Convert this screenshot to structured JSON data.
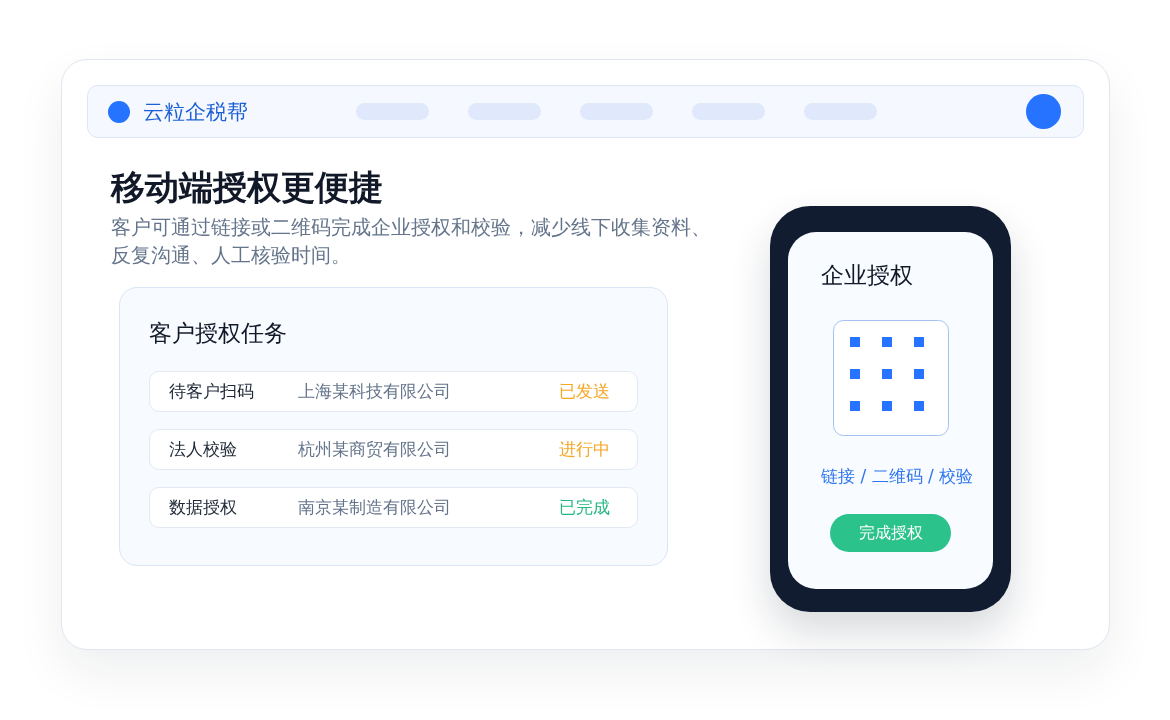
{
  "header": {
    "brand": "云粒企税帮"
  },
  "hero": {
    "title": "移动端授权更便捷",
    "description": "客户可通过链接或二维码完成企业授权和校验，减少线下收集资料、反复沟通、人工核验时间。"
  },
  "task_panel": {
    "title": "客户授权任务",
    "rows": [
      {
        "task": "待客户扫码",
        "company": "上海某科技有限公司",
        "status": "已发送",
        "color": "#f5a623"
      },
      {
        "task": "法人校验",
        "company": "杭州某商贸有限公司",
        "status": "进行中",
        "color": "#f5a623"
      },
      {
        "task": "数据授权",
        "company": "南京某制造有限公司",
        "status": "已完成",
        "color": "#25b882"
      }
    ]
  },
  "phone": {
    "title": "企业授权",
    "caption": "链接 / 二维码 / 校验",
    "button": "完成授权"
  }
}
